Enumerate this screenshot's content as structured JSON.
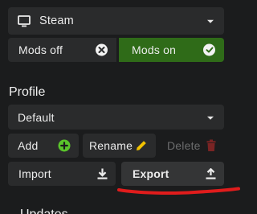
{
  "platform": {
    "selected": "Steam",
    "icon": "monitor-icon"
  },
  "mods": {
    "off_label": "Mods off",
    "on_label": "Mods on",
    "active": "on"
  },
  "profile": {
    "heading": "Profile",
    "selected": "Default",
    "buttons": {
      "add": "Add",
      "rename": "Rename",
      "delete": "Delete",
      "import": "Import",
      "export": "Export"
    }
  },
  "next_section": {
    "heading": "Updates"
  },
  "colors": {
    "background": "#1b1c1d",
    "control": "#2a2b2c",
    "mods_on": "#2f6b18",
    "add_icon": "#5ac42b",
    "rename_icon": "#f2c200",
    "delete_icon": "#7a2424",
    "annotation": "#e01c1c"
  }
}
